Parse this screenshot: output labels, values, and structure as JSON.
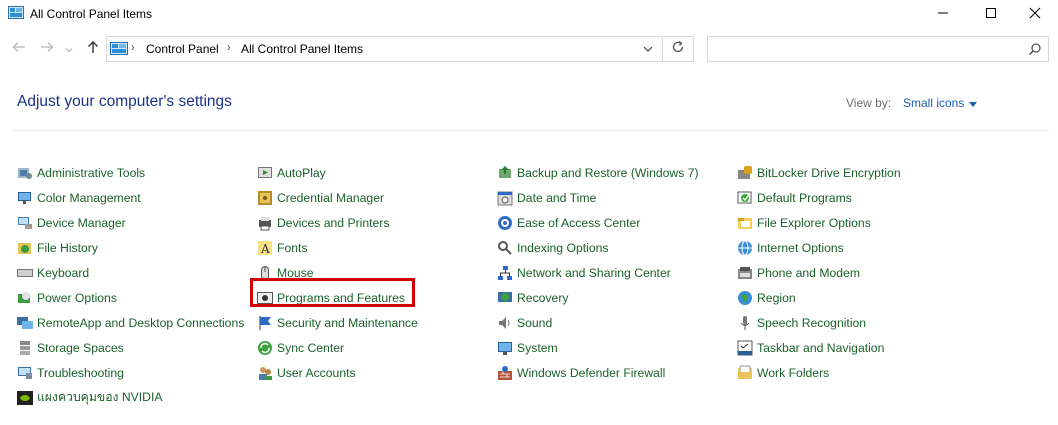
{
  "window": {
    "title": "All Control Panel Items",
    "icon": "control-panel-icon",
    "controls": [
      "minimize-icon",
      "maximize-icon",
      "close-icon"
    ]
  },
  "address": {
    "breadcrumb": [
      "Control Panel",
      "All Control Panel Items"
    ],
    "search_placeholder": ""
  },
  "header": {
    "title": "Adjust your computer's settings",
    "view_by_label": "View by:",
    "view_by_value": "Small icons"
  },
  "colors": {
    "link": "#1b5f2c",
    "heading": "#1e3287",
    "view_by_value": "#1a5fb4",
    "highlight": "#d20000"
  },
  "columns": [
    [
      {
        "label": "Administrative Tools",
        "icon": "admin-tools-icon"
      },
      {
        "label": "Color Management",
        "icon": "color-management-icon"
      },
      {
        "label": "Device Manager",
        "icon": "device-manager-icon"
      },
      {
        "label": "File History",
        "icon": "file-history-icon"
      },
      {
        "label": "Keyboard",
        "icon": "keyboard-icon"
      },
      {
        "label": "Power Options",
        "icon": "power-options-icon"
      },
      {
        "label": "RemoteApp and Desktop Connections",
        "icon": "remoteapp-icon"
      },
      {
        "label": "Storage Spaces",
        "icon": "storage-spaces-icon"
      },
      {
        "label": "Troubleshooting",
        "icon": "troubleshooting-icon"
      },
      {
        "label": "แผงควบคุมของ NVIDIA",
        "icon": "nvidia-icon"
      }
    ],
    [
      {
        "label": "AutoPlay",
        "icon": "autoplay-icon"
      },
      {
        "label": "Credential Manager",
        "icon": "credential-manager-icon"
      },
      {
        "label": "Devices and Printers",
        "icon": "devices-printers-icon"
      },
      {
        "label": "Fonts",
        "icon": "fonts-icon"
      },
      {
        "label": "Mouse",
        "icon": "mouse-icon"
      },
      {
        "label": "Programs and Features",
        "icon": "programs-features-icon"
      },
      {
        "label": "Security and Maintenance",
        "icon": "security-flag-icon"
      },
      {
        "label": "Sync Center",
        "icon": "sync-center-icon"
      },
      {
        "label": "User Accounts",
        "icon": "user-accounts-icon"
      }
    ],
    [
      {
        "label": "Backup and Restore (Windows 7)",
        "icon": "backup-restore-icon"
      },
      {
        "label": "Date and Time",
        "icon": "date-time-icon"
      },
      {
        "label": "Ease of Access Center",
        "icon": "ease-of-access-icon"
      },
      {
        "label": "Indexing Options",
        "icon": "indexing-options-icon"
      },
      {
        "label": "Network and Sharing Center",
        "icon": "network-sharing-icon"
      },
      {
        "label": "Recovery",
        "icon": "recovery-icon"
      },
      {
        "label": "Sound",
        "icon": "sound-icon"
      },
      {
        "label": "System",
        "icon": "system-icon"
      },
      {
        "label": "Windows Defender Firewall",
        "icon": "firewall-icon"
      }
    ],
    [
      {
        "label": "BitLocker Drive Encryption",
        "icon": "bitlocker-icon"
      },
      {
        "label": "Default Programs",
        "icon": "default-programs-icon"
      },
      {
        "label": "File Explorer Options",
        "icon": "file-explorer-options-icon"
      },
      {
        "label": "Internet Options",
        "icon": "internet-options-icon"
      },
      {
        "label": "Phone and Modem",
        "icon": "phone-modem-icon"
      },
      {
        "label": "Region",
        "icon": "region-icon"
      },
      {
        "label": "Speech Recognition",
        "icon": "speech-recognition-icon"
      },
      {
        "label": "Taskbar and Navigation",
        "icon": "taskbar-navigation-icon"
      },
      {
        "label": "Work Folders",
        "icon": "work-folders-icon"
      }
    ]
  ]
}
